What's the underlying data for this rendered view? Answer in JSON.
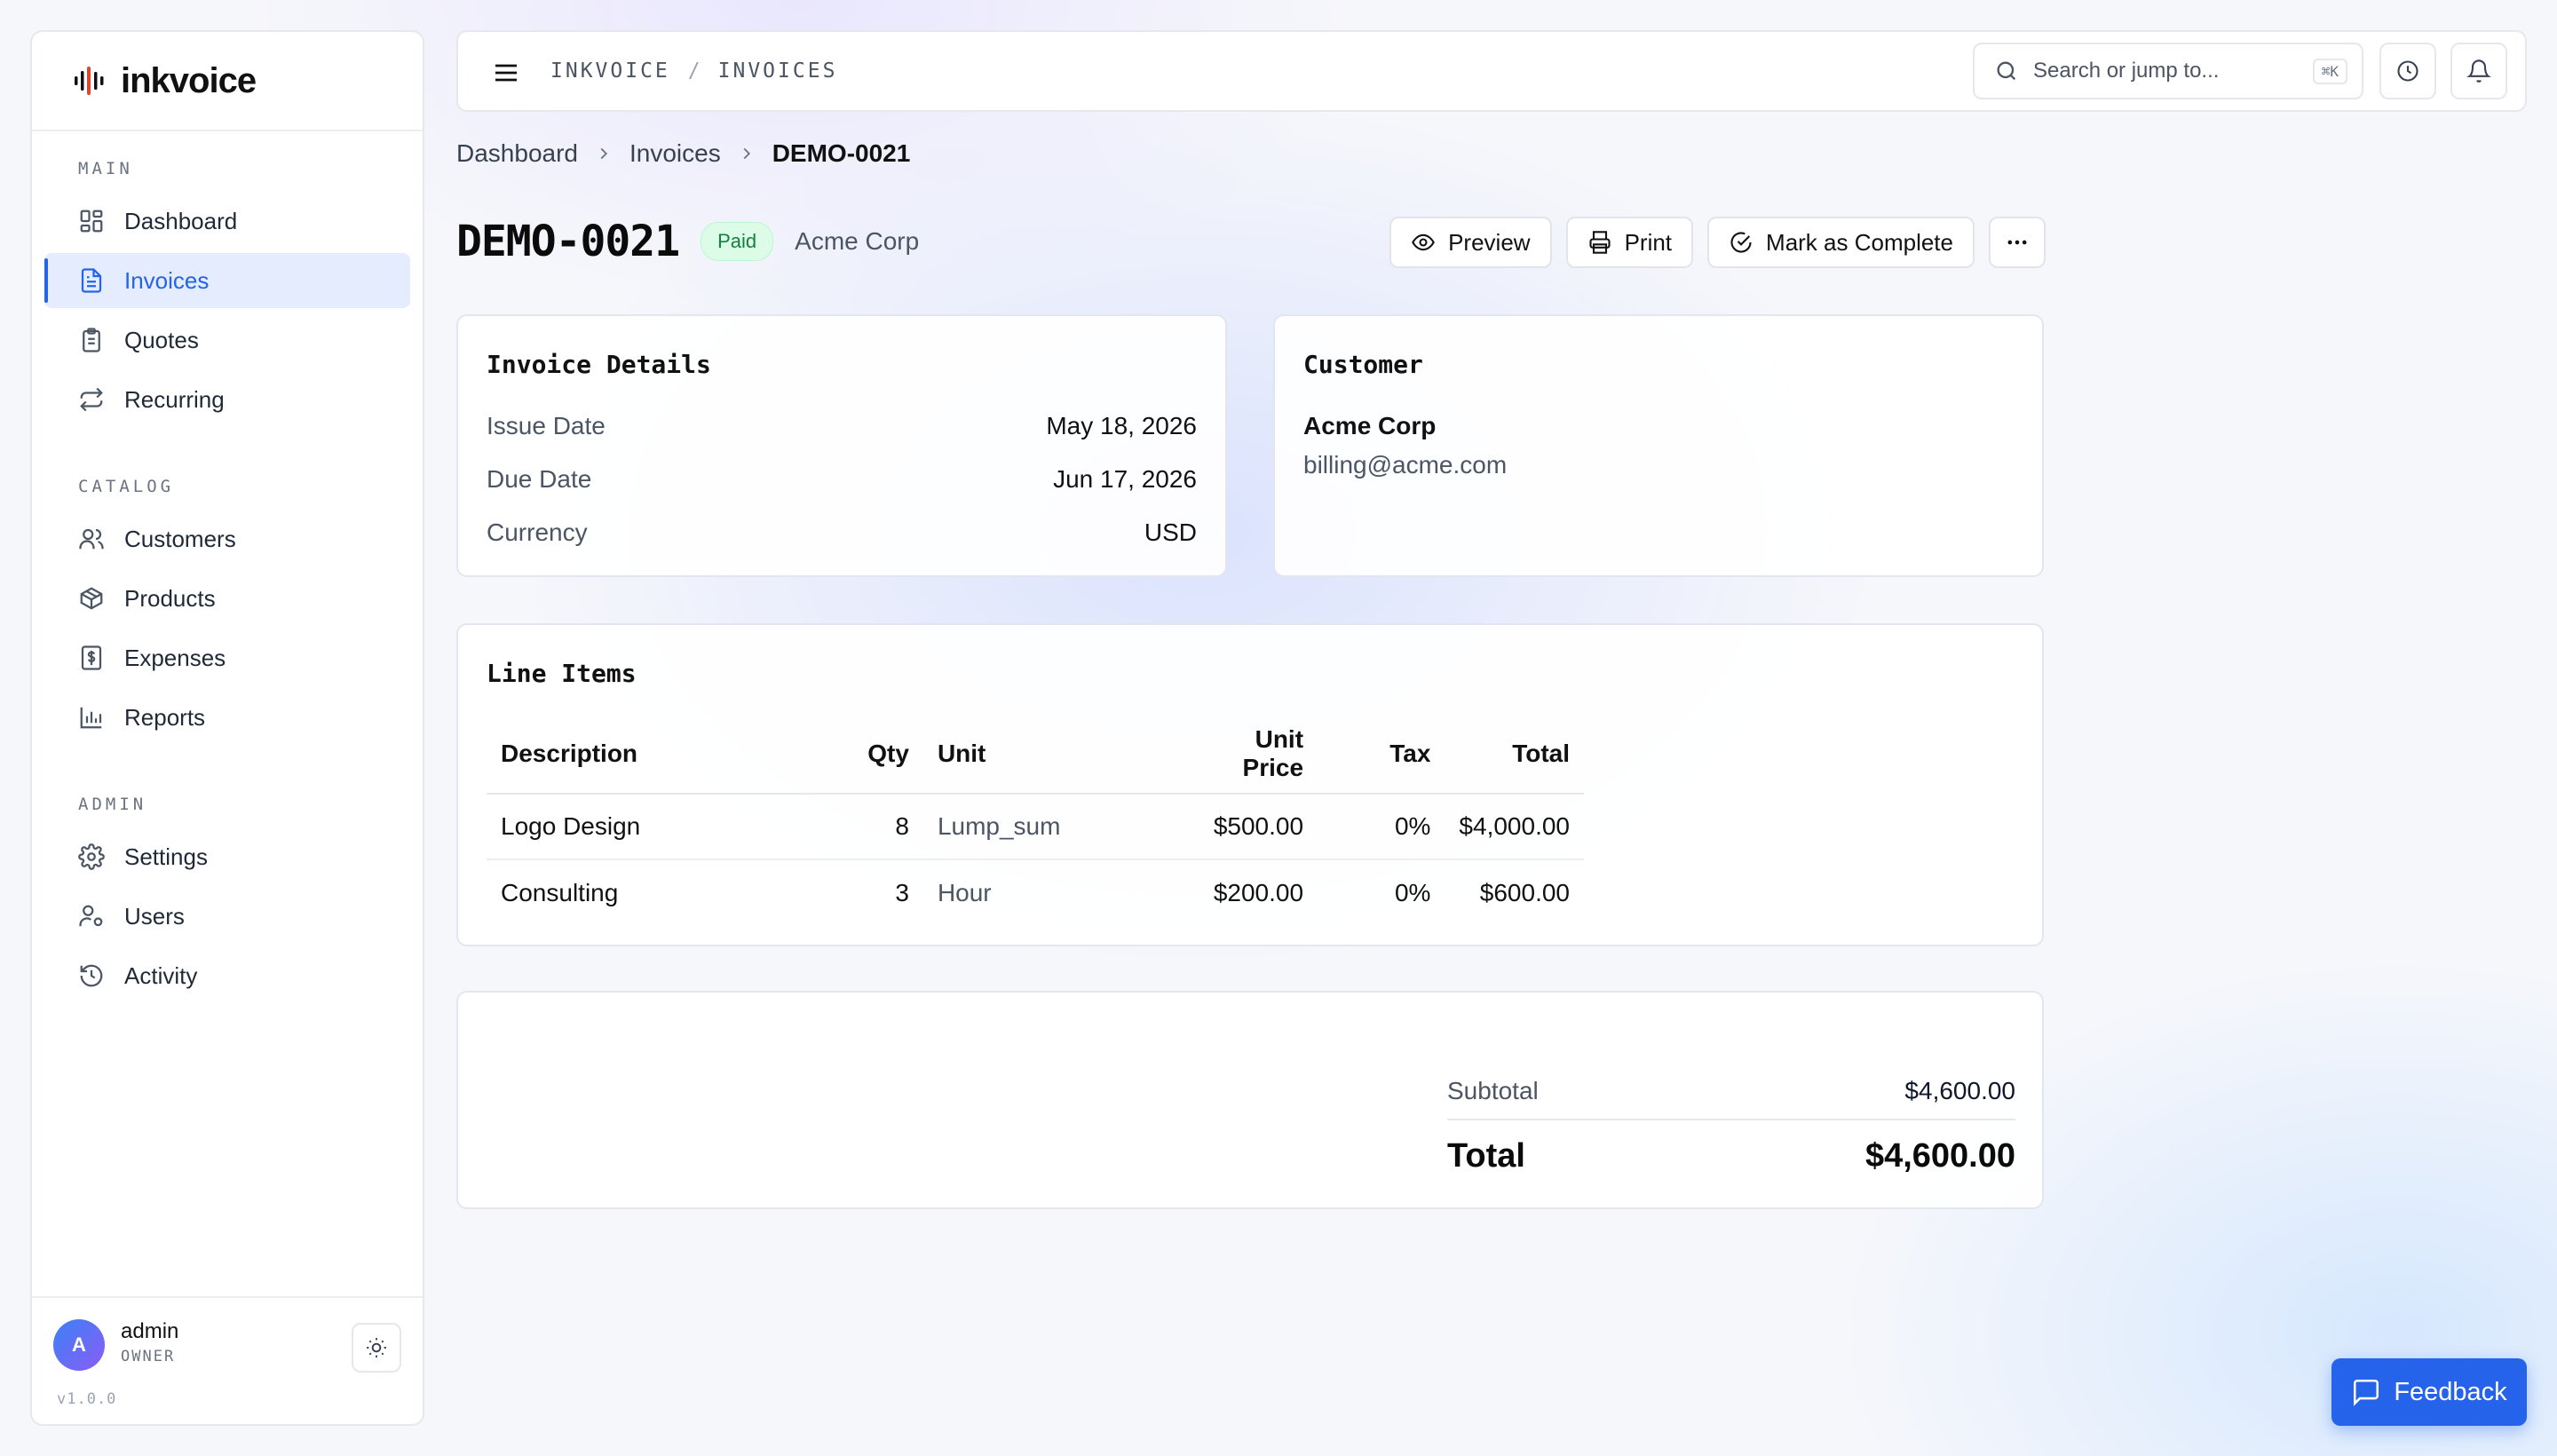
{
  "app": {
    "brand": "inkvoice",
    "version": "v1.0.0"
  },
  "colors": {
    "accent": "#2563eb",
    "paid_badge_bg": "#dcfce7",
    "paid_badge_text": "#15803d"
  },
  "sidebar": {
    "sections": [
      {
        "label": "MAIN",
        "items": [
          {
            "label": "Dashboard",
            "icon": "grid-icon"
          },
          {
            "label": "Invoices",
            "icon": "file-text-icon",
            "active": true
          },
          {
            "label": "Quotes",
            "icon": "clipboard-icon"
          },
          {
            "label": "Recurring",
            "icon": "repeat-icon"
          }
        ]
      },
      {
        "label": "CATALOG",
        "items": [
          {
            "label": "Customers",
            "icon": "users-icon"
          },
          {
            "label": "Products",
            "icon": "box-icon"
          },
          {
            "label": "Expenses",
            "icon": "receipt-icon"
          },
          {
            "label": "Reports",
            "icon": "bar-chart-icon"
          }
        ]
      },
      {
        "label": "ADMIN",
        "items": [
          {
            "label": "Settings",
            "icon": "gear-icon"
          },
          {
            "label": "Users",
            "icon": "user-cog-icon"
          },
          {
            "label": "Activity",
            "icon": "history-icon"
          }
        ]
      }
    ],
    "user": {
      "initial": "A",
      "name": "admin",
      "role": "OWNER"
    }
  },
  "topbar": {
    "crumb_root": "INKVOICE",
    "crumb_sep": "/",
    "crumb_page": "INVOICES",
    "search_placeholder": "Search or jump to...",
    "search_shortcut": "⌘K"
  },
  "breadcrumb": {
    "items": [
      "Dashboard",
      "Invoices"
    ],
    "current": "DEMO-0021"
  },
  "invoice": {
    "number": "DEMO-0021",
    "status": "Paid",
    "customer_name": "Acme Corp",
    "actions": {
      "preview": "Preview",
      "print": "Print",
      "complete": "Mark as Complete"
    }
  },
  "details": {
    "title": "Invoice Details",
    "rows": [
      {
        "label": "Issue Date",
        "value": "May 18, 2026"
      },
      {
        "label": "Due Date",
        "value": "Jun 17, 2026"
      },
      {
        "label": "Currency",
        "value": "USD"
      }
    ]
  },
  "customer": {
    "title": "Customer",
    "name": "Acme Corp",
    "email": "billing@acme.com"
  },
  "line_items": {
    "title": "Line Items",
    "headers": {
      "description": "Description",
      "qty": "Qty",
      "unit": "Unit",
      "unit_price": "Unit Price",
      "tax": "Tax",
      "total": "Total"
    },
    "rows": [
      {
        "description": "Logo Design",
        "qty": "8",
        "unit": "Lump_sum",
        "unit_price": "$500.00",
        "tax": "0%",
        "total": "$4,000.00"
      },
      {
        "description": "Consulting",
        "qty": "3",
        "unit": "Hour",
        "unit_price": "$200.00",
        "tax": "0%",
        "total": "$600.00"
      }
    ]
  },
  "totals": {
    "subtotal_label": "Subtotal",
    "subtotal": "$4,600.00",
    "total_label": "Total",
    "total": "$4,600.00"
  },
  "feedback": {
    "label": "Feedback"
  }
}
